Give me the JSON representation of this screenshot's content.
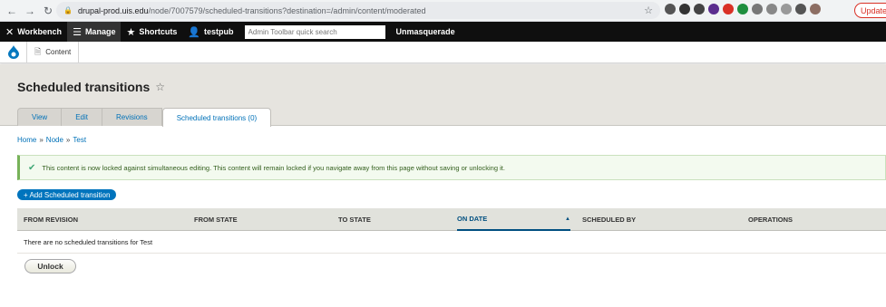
{
  "browser": {
    "url_host": "drupal-prod.uis.edu",
    "url_path": "/node/7007579/scheduled-transitions?destination=/admin/content/moderated",
    "update_label": "Update"
  },
  "toolbar": {
    "workbench": "Workbench",
    "manage": "Manage",
    "shortcuts": "Shortcuts",
    "user": "testpub",
    "search_placeholder": "Admin Toolbar quick search",
    "unmasquerade": "Unmasquerade"
  },
  "secondary": {
    "content": "Content"
  },
  "page": {
    "title": "Scheduled transitions",
    "tabs": [
      {
        "label": "View"
      },
      {
        "label": "Edit"
      },
      {
        "label": "Revisions"
      },
      {
        "label": "Scheduled transitions (0)"
      }
    ]
  },
  "breadcrumb": {
    "items": [
      "Home",
      "Node",
      "Test"
    ],
    "separator": "»"
  },
  "status": {
    "message": "This content is now locked against simultaneous editing. This content will remain locked if you navigate away from this page without saving or unlocking it."
  },
  "actions": {
    "add": "+ Add Scheduled transition",
    "unlock": "Unlock"
  },
  "table": {
    "headers": [
      "From revision",
      "From state",
      "To state",
      "On date",
      "Scheduled by",
      "Operations"
    ],
    "empty": "There are no scheduled transitions for Test"
  },
  "colors": {
    "toolbar_bg": "#0f0f0f",
    "link": "#0071b8",
    "status_green": "#77b259",
    "primary_button": "#0074bd"
  }
}
